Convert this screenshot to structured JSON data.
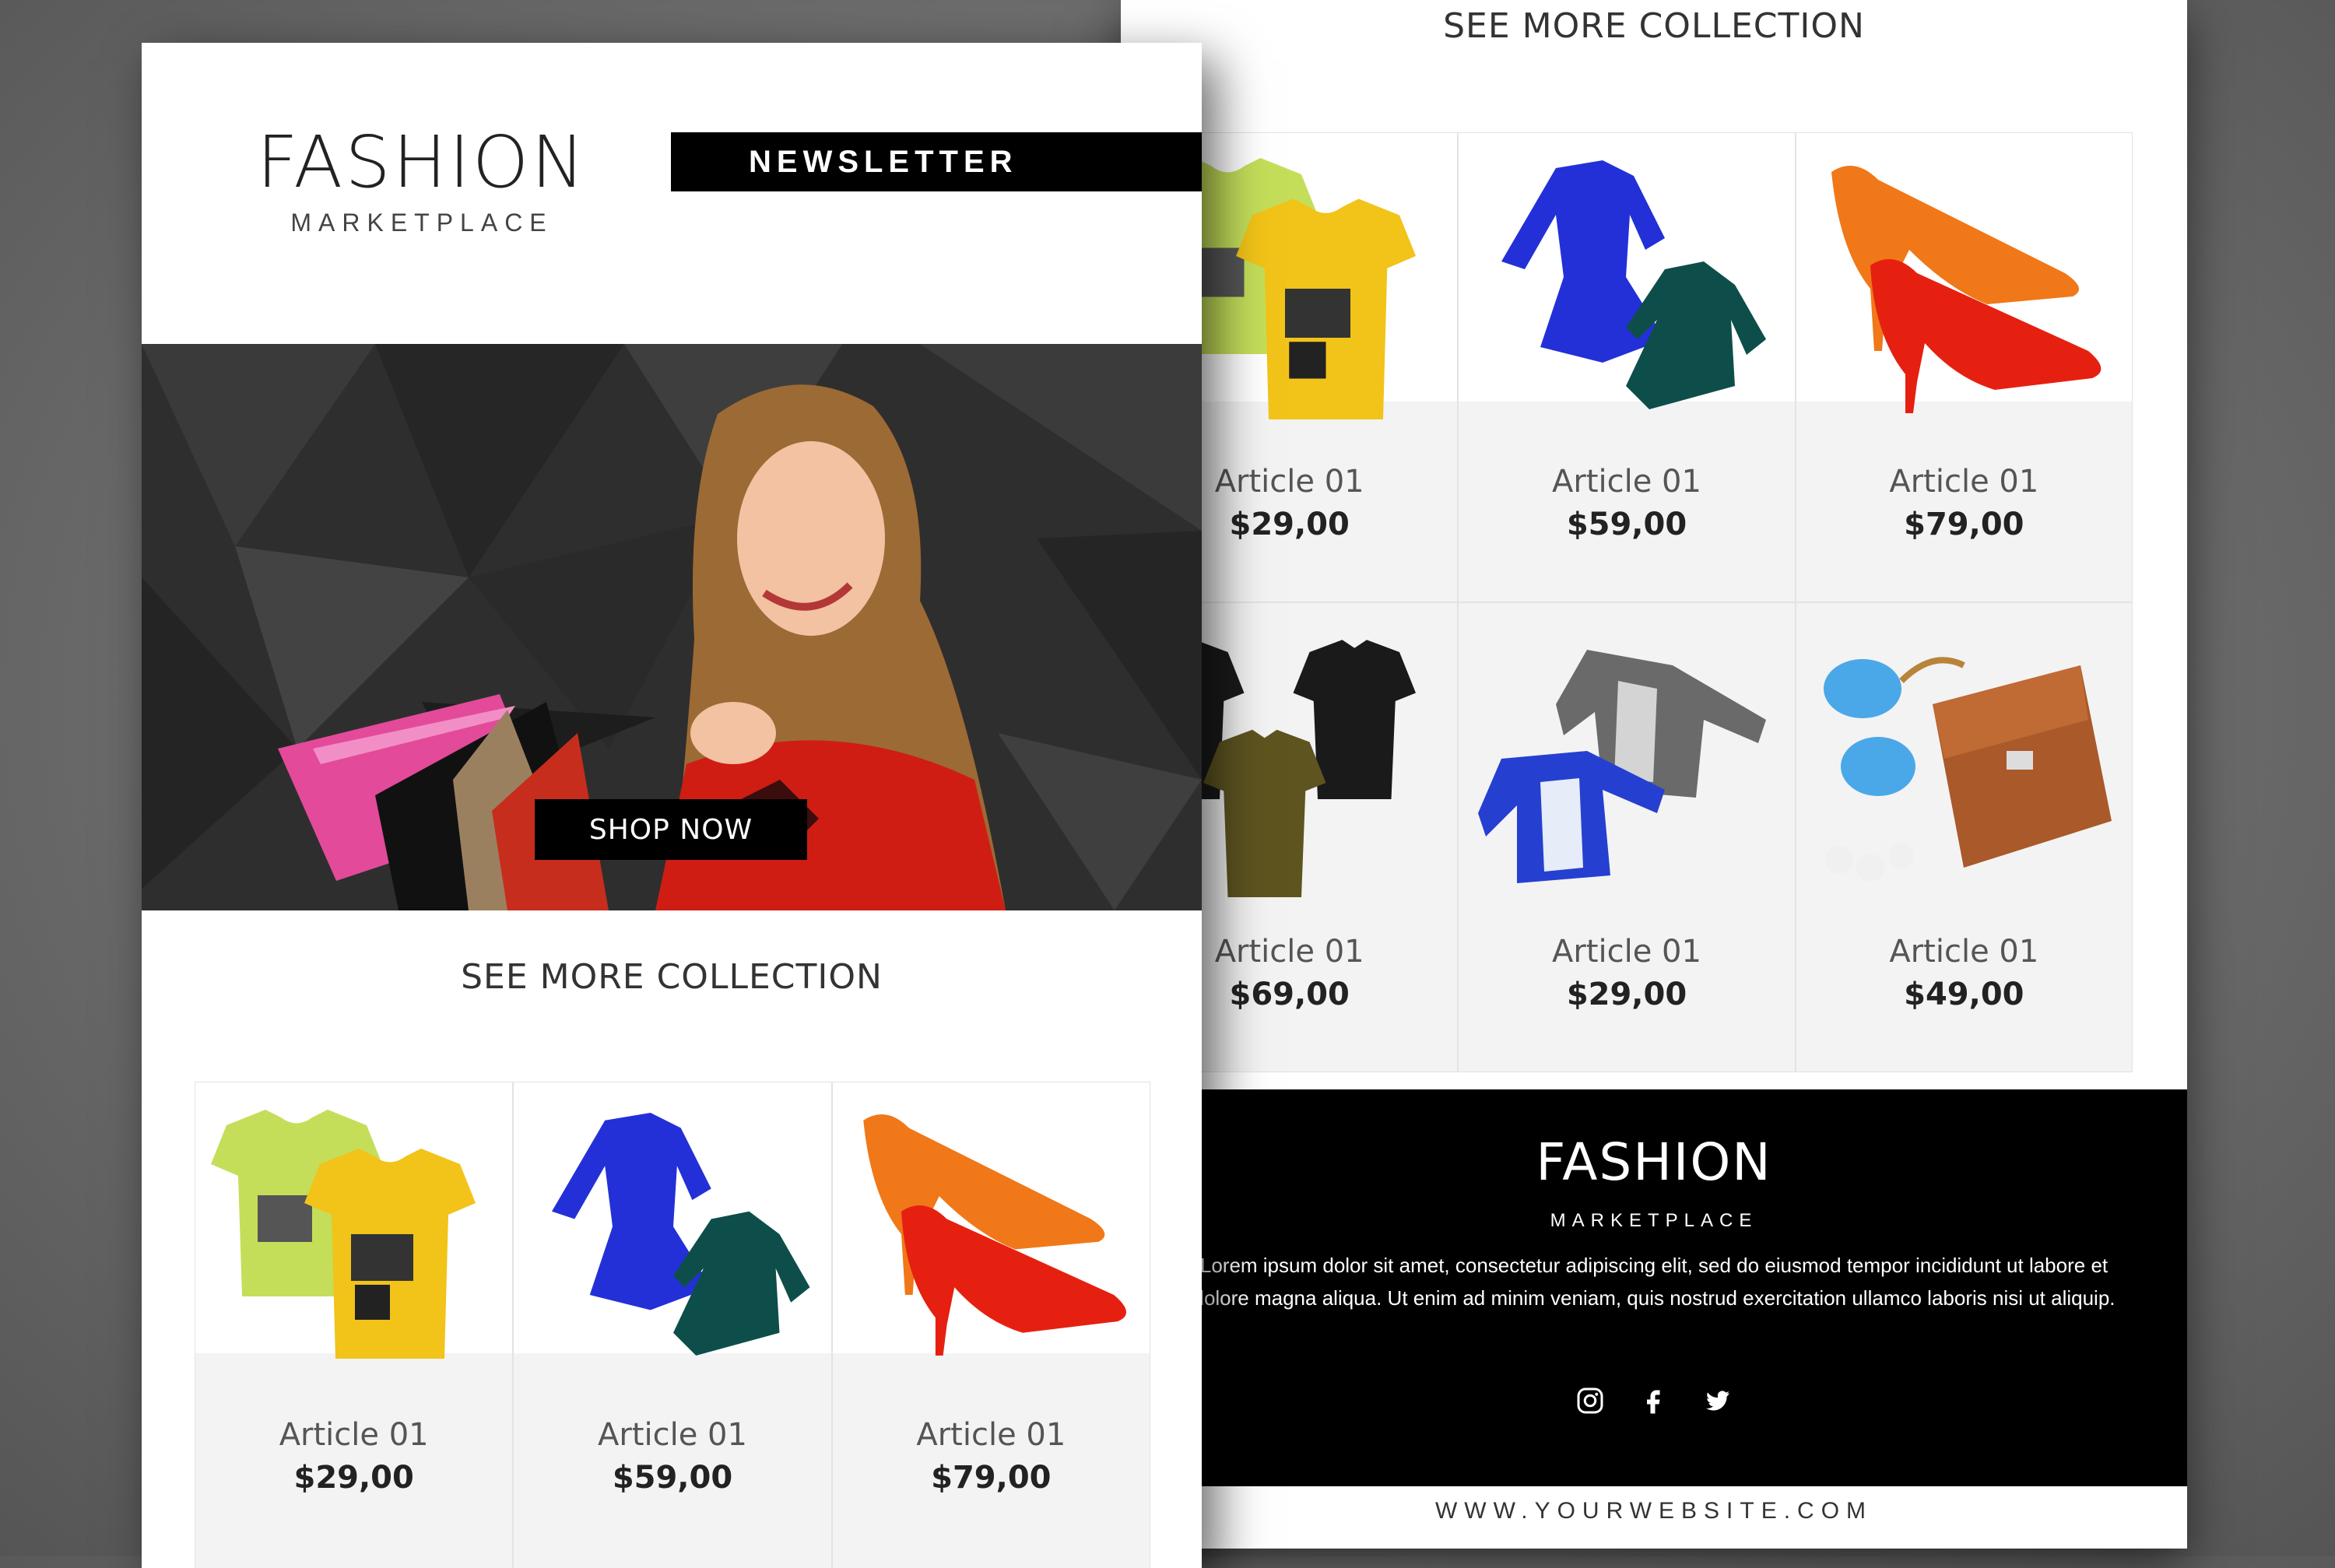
{
  "back": {
    "section_title": "SEE MORE COLLECTION",
    "products": [
      {
        "name": "Article 01",
        "price": "$29,00",
        "icon": "tshirts-image"
      },
      {
        "name": "Article 01",
        "price": "$59,00",
        "icon": "dresses-image"
      },
      {
        "name": "Article 01",
        "price": "$79,00",
        "icon": "heels-image"
      },
      {
        "name": "Article 01",
        "price": "$69,00",
        "icon": "polo-shirts-image"
      },
      {
        "name": "Article 01",
        "price": "$29,00",
        "icon": "jackets-image"
      },
      {
        "name": "Article 01",
        "price": "$49,00",
        "icon": "sunglasses-bag-image"
      }
    ],
    "footer": {
      "brand": "FASHION",
      "brand_sub": "MARKETPLACE",
      "body": "Lorem ipsum dolor sit amet, consectetur adipiscing elit, sed do eiusmod tempor incididunt ut labore et dolore magna aliqua. Ut enim ad minim veniam, quis nostrud exercitation ullamco laboris nisi ut aliquip.",
      "social": [
        "instagram-icon",
        "facebook-icon",
        "twitter-icon"
      ]
    },
    "website": "WWW.YOURWEBSITE.COM"
  },
  "front": {
    "brand": "FASHION",
    "brand_sub": "MARKETPLACE",
    "newsletter_label": "NEWSLETTER",
    "hero_button": "SHOP NOW",
    "section_title": "SEE MORE COLLECTION",
    "products": [
      {
        "name": "Article 01",
        "price": "$29,00"
      },
      {
        "name": "Article 01",
        "price": "$59,00"
      },
      {
        "name": "Article 01",
        "price": "$79,00"
      }
    ]
  }
}
